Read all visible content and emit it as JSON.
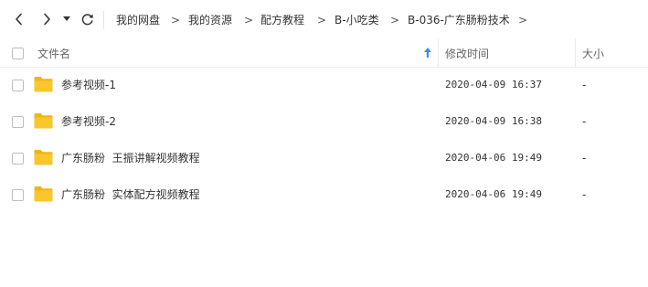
{
  "toolbar": {
    "back_icon": "chevron-left-icon",
    "forward_icon": "chevron-right-icon",
    "history_dropdown_icon": "caret-down-icon",
    "refresh_icon": "refresh-icon",
    "separator": ">"
  },
  "breadcrumb": [
    "我的网盘",
    "我的资源",
    "配方教程",
    "B-小吃类",
    "B-036-广东肠粉技术"
  ],
  "columns": {
    "name": "文件名",
    "modified": "修改时间",
    "size": "大小",
    "sort_icon": "sort-up-arrow-icon",
    "sort_color": "#3b8cff"
  },
  "files": [
    {
      "name": "参考视频-1",
      "modified": "2020-04-09 16:37",
      "size": "-",
      "icon": "folder-icon"
    },
    {
      "name": "参考视频-2",
      "modified": "2020-04-09 16:38",
      "size": "-",
      "icon": "folder-icon"
    },
    {
      "name": "广东肠粉  王振讲解视频教程",
      "modified": "2020-04-06 19:49",
      "size": "-",
      "icon": "folder-icon"
    },
    {
      "name": "广东肠粉  实体配方视频教程",
      "modified": "2020-04-06 19:49",
      "size": "-",
      "icon": "folder-icon"
    }
  ],
  "colors": {
    "folder": "#f8c72b",
    "folder_tab": "#f0b416",
    "accent": "#3b8cff"
  }
}
